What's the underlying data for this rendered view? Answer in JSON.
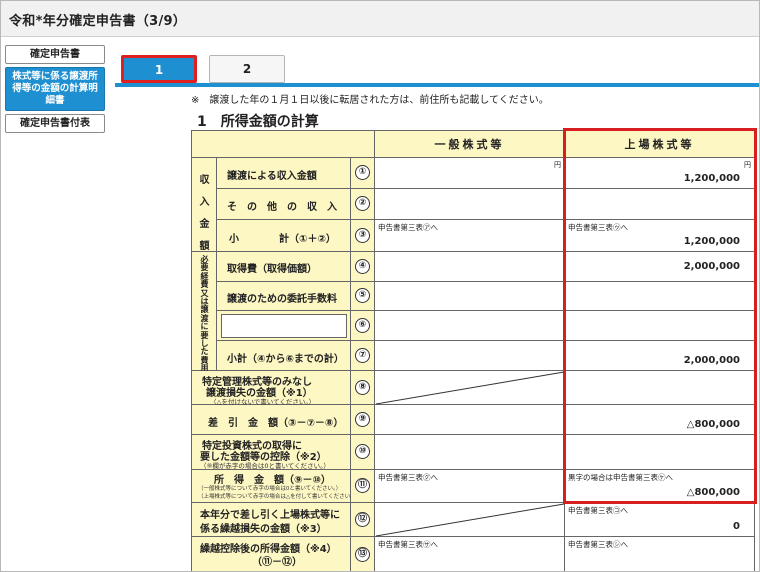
{
  "window": {
    "title": "令和*年分確定申告書（3/9）"
  },
  "sidebar": {
    "items": [
      {
        "label": "確定申告書"
      },
      {
        "label": "株式等に係る譲渡所得等の金額の計算明細書"
      },
      {
        "label": "確定申告書付表"
      }
    ]
  },
  "tabs": [
    {
      "label": "1"
    },
    {
      "label": "2"
    }
  ],
  "note": "※　譲渡した年の１月１日以後に転居された方は、前住所も記載してください。",
  "section_title": "1　所得金額の計算",
  "table": {
    "col_general": "一般株式等",
    "col_listed": "上場株式等",
    "group_income": "収入金額",
    "group_expense": "必要経費又は譲渡に要した費用等",
    "unit": "円",
    "rows": {
      "r1": {
        "num": "①",
        "label": "譲渡による収入金額",
        "listed_value": "1,200,000"
      },
      "r2": {
        "num": "②",
        "label": "そ　の　他　の　収　入"
      },
      "r3": {
        "num": "③",
        "label_a": "小",
        "label_b": "計（①＋②）",
        "general_ref": "申告書第三表㋐へ",
        "listed_ref": "申告書第三表㋒へ",
        "listed_value": "1,200,000"
      },
      "r4": {
        "num": "④",
        "label": "取得費（取得価額）",
        "listed_value": "2,000,000"
      },
      "r5": {
        "num": "⑤",
        "label": "譲渡のための委託手数料"
      },
      "r6": {
        "num": "⑥"
      },
      "r7": {
        "num": "⑦",
        "label": "小計（④から⑥までの計）",
        "listed_value": "2,000,000"
      },
      "r8": {
        "num": "⑧",
        "label_1": "特定管理株式等のみなし",
        "label_2": "譲渡損失の金額（※1）",
        "label_3": "（△を付けないで書いてください。）"
      },
      "r9": {
        "num": "⑨",
        "label": "差　引　金　額（③－⑦－⑧）",
        "listed_value": "△800,000"
      },
      "r10": {
        "num": "⑩",
        "label_1": "特定投資株式の取得に",
        "label_2": "要した金額等の控除（※2）",
        "label_3": "（⑨欄が赤字の場合は0と書いてください。）"
      },
      "r11": {
        "num": "⑪",
        "label_1": "所　得　金　額（⑨－⑩）",
        "label_2": "（一般株式等について赤字の場合は0と書いてください。）",
        "label_3": "（上場株式等について赤字の場合は△を付して書いてください。）",
        "general_ref": "申告書第三表㋗へ",
        "listed_ref": "黒字の場合は申告書第三表㋘へ",
        "listed_value": "△800,000"
      },
      "r12": {
        "num": "⑫",
        "label_1": "本年分で差し引く上場株式等に",
        "label_2": "係る繰越損失の金額（※3）",
        "listed_ref": "申告書第三表㋙へ",
        "listed_value": "0"
      },
      "r13": {
        "num": "⑬",
        "label_1": "繰越控除後の所得金額（※4）",
        "label_2": "（⑪－⑫）",
        "general_ref": "申告書第三表㋚へ",
        "listed_ref": "申告書第三表㋛へ"
      }
    }
  }
}
